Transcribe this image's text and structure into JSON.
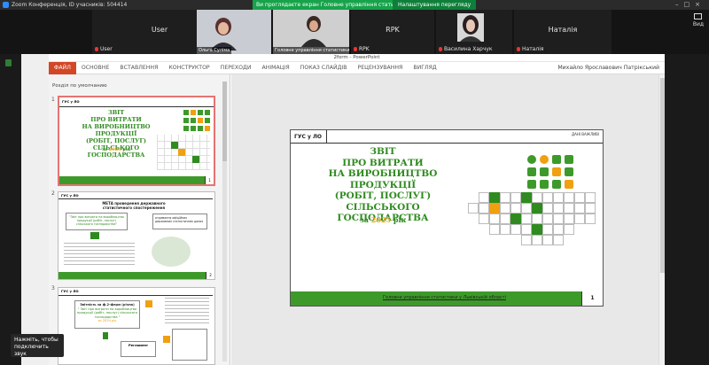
{
  "zoom": {
    "window_title": "Zoom Конференція, ID учасників: 504414",
    "share_banner": "Ви проглядаєте екран Головне управління статистики...",
    "share_settings": "Налаштування перегляду",
    "view_label": "Вид"
  },
  "participants": [
    {
      "name": "User"
    },
    {
      "name": "Ольга Суліма"
    },
    {
      "name": "Головне управління статистики ..."
    },
    {
      "name": "RPK"
    },
    {
      "name": "Василина Харчук"
    },
    {
      "name": "Наталія"
    }
  ],
  "participant_tiles": {
    "user_center": "User",
    "rpk_center": "RPK",
    "rpk_footer": "RPK",
    "natalia_center": "Наталія",
    "natalia_footer": "Наталія"
  },
  "powerpoint": {
    "file_title": "2form - PowerPoint",
    "tabs": [
      "ФАЙЛ",
      "ОСНОВНЕ",
      "ВСТАВЛЕННЯ",
      "КОНСТРУКТОР",
      "ПЕРЕХОДИ",
      "АНІМАЦІЯ",
      "ПОКАЗ СЛАЙДІВ",
      "РЕЦЕНЗУВАННЯ",
      "ВИГЛЯД"
    ],
    "user": "Михайло Ярославович Патрікський",
    "section": "Розділ по умолчанию",
    "thumbnail_numbers": [
      "1",
      "2",
      "3"
    ]
  },
  "slide": {
    "org": "ГУС у ЛО",
    "corner": "ДАНІ ВАЖЛИВІ",
    "title_lines": [
      "ЗВІТ",
      "ПРО ВИТРАТИ",
      "НА ВИРОБНИЦТВО ПРОДУКЦІЇ",
      "(РОБІТ, ПОСЛУГ) СІЛЬСЬКОГО",
      "ГОСПОДАРСТВА"
    ],
    "year_prefix": "за",
    "year": "2025",
    "year_suffix": "рік",
    "footer": "Головне управління статистики у Львівській області",
    "page": "1"
  },
  "thumb2": {
    "heading": "МЕТА проведення державного статистичного спостереження",
    "left_box": "\"Звіт про витрати на виробництво продукції (робіт, послуг) сільського господарства\"",
    "right_box": "отримання офіційних державних статистичних даних",
    "page": "2"
  },
  "thumb3": {
    "heading": "Звітність за ф.2-ферм (річна)",
    "sub": "\" Звіт про витрати на виробництво продукції (робіт, послуг) сільського господарства \"",
    "year": "за 2024 рік",
    "bottom": "Регламент"
  },
  "toast": {
    "line1": "Нажміть, чтобы",
    "line2": "подключить звук"
  },
  "colors": {
    "accent_green": "#2f8b1f",
    "accent_yellow": "#f0a010",
    "ppt_file": "#d24726",
    "zoom_share": "#16a34a"
  }
}
